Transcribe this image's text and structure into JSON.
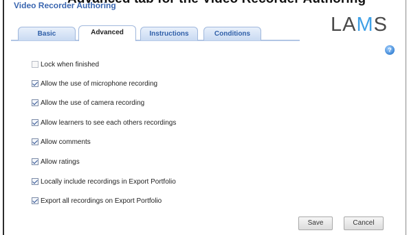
{
  "page_heading": "Advanced tab for the Video Recorder Authoring",
  "window": {
    "title": "Video Recorder Authoring",
    "logo": {
      "part1": "LA",
      "part2": "M",
      "part3": "S"
    }
  },
  "tabs": [
    {
      "label": "Basic",
      "active": false
    },
    {
      "label": "Advanced",
      "active": true
    },
    {
      "label": "Instructions",
      "active": false
    },
    {
      "label": "Conditions",
      "active": false
    }
  ],
  "help_icon": {
    "name": "help-icon",
    "glyph": "?"
  },
  "options": [
    {
      "label": "Lock when finished",
      "checked": false
    },
    {
      "label": "Allow the use of microphone recording",
      "checked": true
    },
    {
      "label": "Allow the use of camera recording",
      "checked": true
    },
    {
      "label": "Allow learners to see each others recordings",
      "checked": true
    },
    {
      "label": "Allow comments",
      "checked": true
    },
    {
      "label": "Allow ratings",
      "checked": true
    },
    {
      "label": "Locally include recordings in Export Portfolio",
      "checked": true
    },
    {
      "label": "Export all recordings on Export Portfolio",
      "checked": true
    }
  ],
  "buttons": {
    "save_label": "Save",
    "cancel_label": "Cancel"
  },
  "colors": {
    "title": "#3a66b0",
    "tab_text": "#2f5fa8",
    "logo_accent": "#3fa0e6"
  }
}
